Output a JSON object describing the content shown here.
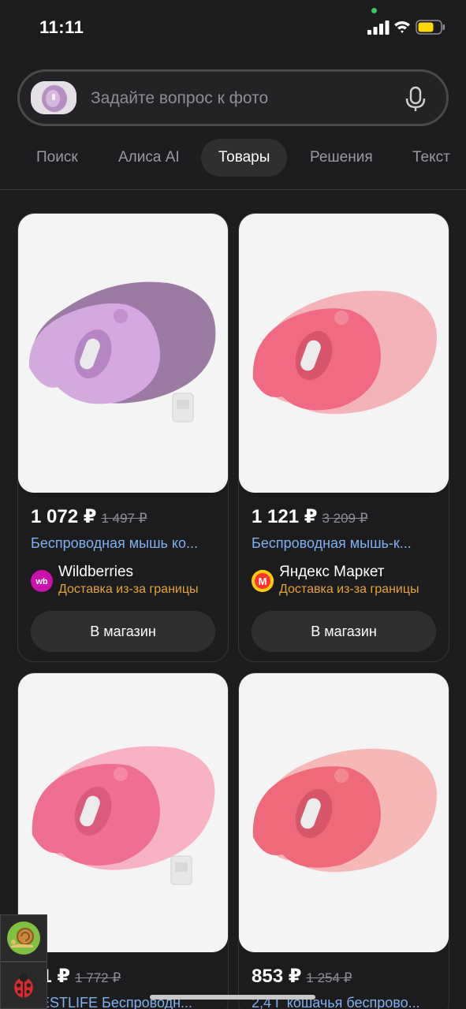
{
  "status": {
    "time": "11:11"
  },
  "search": {
    "placeholder": "Задайте вопрос к фото"
  },
  "tabs": [
    {
      "label": "Поиск"
    },
    {
      "label": "Алиса AI"
    },
    {
      "label": "Товары",
      "active": true
    },
    {
      "label": "Решения"
    },
    {
      "label": "Текст"
    }
  ],
  "products": [
    {
      "price": "1 072 ₽",
      "old_price": "1 497 ₽",
      "title": "Беспроводная мышь ко...",
      "shop": "Wildberries",
      "delivery": "Доставка из-за границы",
      "button": "В магазин",
      "color": "#c9a6d8"
    },
    {
      "price": "1 121 ₽",
      "old_price": "3 209 ₽",
      "title": "Беспроводная мышь-к...",
      "shop": "Яндекс Маркет",
      "delivery": "Доставка из-за границы",
      "button": "В магазин",
      "color": "#f0879d"
    },
    {
      "price": "51 ₽",
      "old_price": "1 772 ₽",
      "title": "BESTLIFE Беспроводн...",
      "color": "#f08aa6"
    },
    {
      "price": "853 ₽",
      "old_price": "1 254 ₽",
      "title": "2,4 Г кошачья беспрово...",
      "color": "#f3a0a6"
    }
  ],
  "colors": {
    "accent_link": "#7fb0ef",
    "delivery": "#e2a33a",
    "wildberries": "#cb11ab",
    "yandex_market": "#ffcc00"
  }
}
